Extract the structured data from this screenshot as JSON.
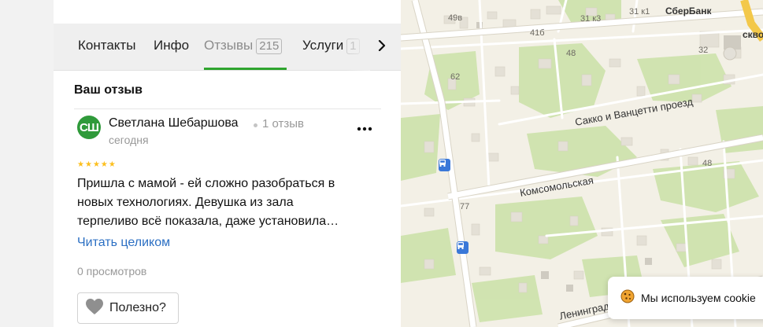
{
  "tabs": [
    {
      "label": "Контакты"
    },
    {
      "label": "Инфо"
    },
    {
      "label": "Отзывы",
      "badge": "215"
    },
    {
      "label": "Услуги",
      "badge": "1"
    }
  ],
  "active_tab": "Отзывы",
  "section_title": "Ваш отзыв",
  "review": {
    "avatar_initials": "СШ",
    "author": "Светлана Шебаршова",
    "author_reviews": "1 отзыв",
    "date": "сегодня",
    "rating": 5,
    "text_lines": [
      "Пришла с мамой - ей сложно разобраться в",
      "новых технологиях. Девушка из зала",
      "терпеливо всё показала, даже установила…"
    ],
    "read_more": "Читать целиком",
    "views": "0 просмотров",
    "helpful_label": "Полезно?"
  },
  "map": {
    "streets": [
      "Сакко и Ванцетти проезд",
      "Комсомольская",
      "Ленинград"
    ],
    "house_numbers": [
      "49в",
      "41б",
      "31 к3",
      "31 к1",
      "48",
      "32",
      "62",
      "48",
      "77"
    ],
    "poi": [
      "СберБанк",
      "скво"
    ]
  },
  "cookie_banner": "Мы используем cookie",
  "colors": {
    "accent_green": "#2fa52e",
    "avatar_green": "#2f9a3a",
    "link_blue": "#2b6fc3",
    "star_yellow": "#fcbf1e",
    "bus_stop_blue": "#3a78d8",
    "map_land": "#f3f0e6",
    "map_green": "#cfe3ae"
  },
  "icons": [
    "chevron-right-icon",
    "more-dots-icon",
    "heart-icon",
    "bus-stop-icon",
    "cookie-icon"
  ]
}
